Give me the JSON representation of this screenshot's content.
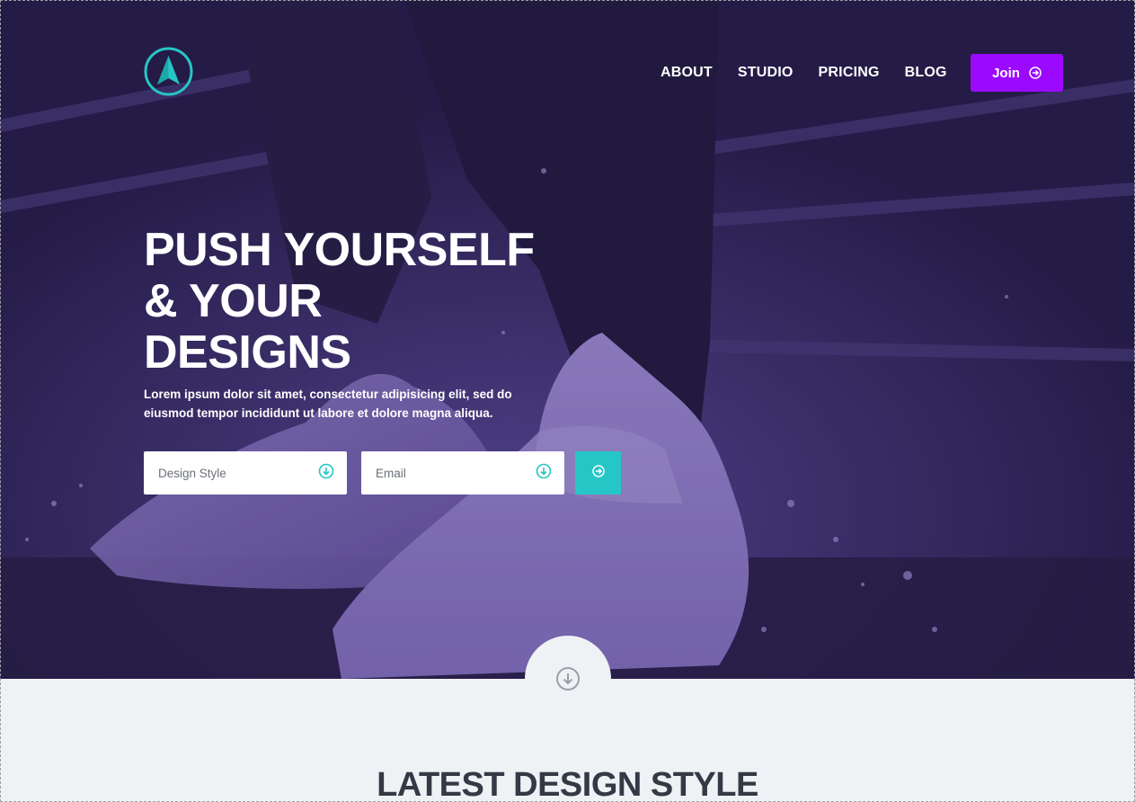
{
  "nav": {
    "logo_icon": "compass-arrow-icon",
    "links": [
      "ABOUT",
      "STUDIO",
      "PRICING",
      "BLOG"
    ],
    "join_label": "Join",
    "join_icon": "arrow-circle-right-icon"
  },
  "hero": {
    "headline_lines": [
      "PUSH YOURSELF",
      "& YOUR",
      "DESIGNS"
    ],
    "subtext": "Lorem ipsum dolor sit amet, consectetur adipisicing elit, sed do eiusmod tempor incididunt ut labore et dolore magna aliqua.",
    "form": {
      "design_placeholder": "Design Style",
      "email_placeholder": "Email",
      "field_icon": "arrow-circle-down-icon",
      "submit_icon": "arrow-circle-right-icon"
    },
    "scroll_icon": "arrow-circle-down-icon"
  },
  "section": {
    "title": "LATEST DESIGN STYLE"
  },
  "colors": {
    "hero_overlay": "#2b2150",
    "accent_purple": "#9b0aff",
    "accent_teal": "#26c6c6",
    "light_bg": "#eef2f5",
    "heading_dark": "#343a45"
  }
}
